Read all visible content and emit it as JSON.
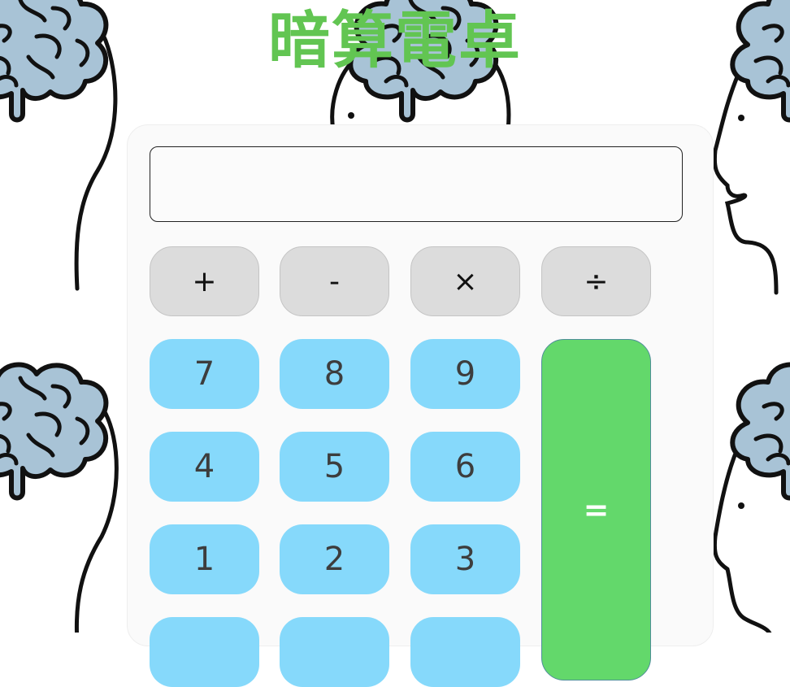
{
  "app": {
    "title": "暗算電卓"
  },
  "display": {
    "value": ""
  },
  "operators": {
    "plus": "+",
    "minus": "-",
    "multiply": "×",
    "divide": "÷"
  },
  "digits": {
    "seven": "7",
    "eight": "8",
    "nine": "9",
    "four": "4",
    "five": "5",
    "six": "6",
    "one": "1",
    "two": "2",
    "three": "3"
  },
  "equals": {
    "label": "="
  },
  "colors": {
    "title": "#62c552",
    "operator_key": "#dcdcdc",
    "digit_key": "#86d9fb",
    "equals_key": "#63d86b",
    "brain": "#a8c3d6",
    "panel": "#fafafa"
  },
  "icons": {
    "background": "thinking-head-brain-icon"
  }
}
